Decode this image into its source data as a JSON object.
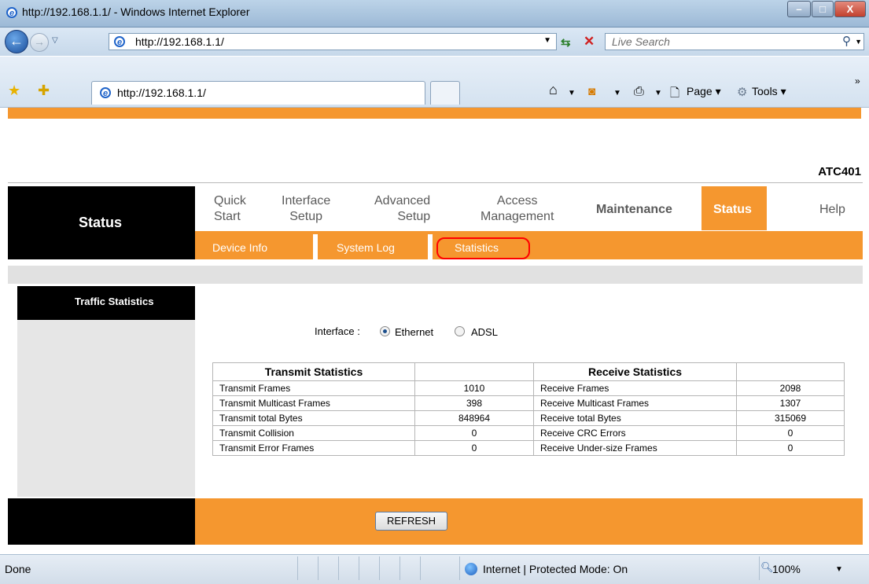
{
  "window": {
    "title": "http://192.168.1.1/ - Windows Internet Explorer",
    "minimize": "–",
    "maximize": "□",
    "close": "X"
  },
  "addressbar": {
    "url": "http://192.168.1.1/",
    "search_placeholder": "Live Search"
  },
  "tab": {
    "title": "http://192.168.1.1/"
  },
  "commandbar": {
    "page_label": "Page",
    "tools_label": "Tools",
    "more": "»"
  },
  "router": {
    "model": "ATC401",
    "section_title": "Status",
    "menu": [
      {
        "line1": "Quick",
        "line2": "Start"
      },
      {
        "line1": "Interface",
        "line2": "Setup"
      },
      {
        "line1": "Advanced",
        "line2": "Setup"
      },
      {
        "line1": "Access",
        "line2": "Management"
      },
      {
        "line1": "Maintenance",
        "line2": ""
      },
      {
        "line1": "Status",
        "line2": ""
      },
      {
        "line1": "Help",
        "line2": ""
      }
    ],
    "submenu": [
      "Device Info",
      "System Log",
      "Statistics"
    ],
    "side_label": "Traffic Statistics",
    "interface_label": "Interface :",
    "interface_options": [
      "Ethernet",
      "ADSL"
    ],
    "interface_selected": "Ethernet",
    "refresh_button": "REFRESH"
  },
  "statistics": {
    "transmit_header": "Transmit Statistics",
    "receive_header": "Receive Statistics",
    "rows": [
      {
        "tx_label": "Transmit Frames",
        "tx_value": "1010",
        "rx_label": "Receive Frames",
        "rx_value": "2098"
      },
      {
        "tx_label": "Transmit Multicast Frames",
        "tx_value": "398",
        "rx_label": "Receive Multicast Frames",
        "rx_value": "1307"
      },
      {
        "tx_label": "Transmit total Bytes",
        "tx_value": "848964",
        "rx_label": "Receive total Bytes",
        "rx_value": "315069"
      },
      {
        "tx_label": "Transmit Collision",
        "tx_value": "0",
        "rx_label": "Receive CRC Errors",
        "rx_value": "0"
      },
      {
        "tx_label": "Transmit Error Frames",
        "tx_value": "0",
        "rx_label": "Receive Under-size Frames",
        "rx_value": "0"
      }
    ]
  },
  "statusbar": {
    "status": "Done",
    "zone": "Internet | Protected Mode: On",
    "zoom": "100%"
  },
  "colors": {
    "accent_orange": "#f5972f",
    "highlight_red": "#ff0000"
  }
}
